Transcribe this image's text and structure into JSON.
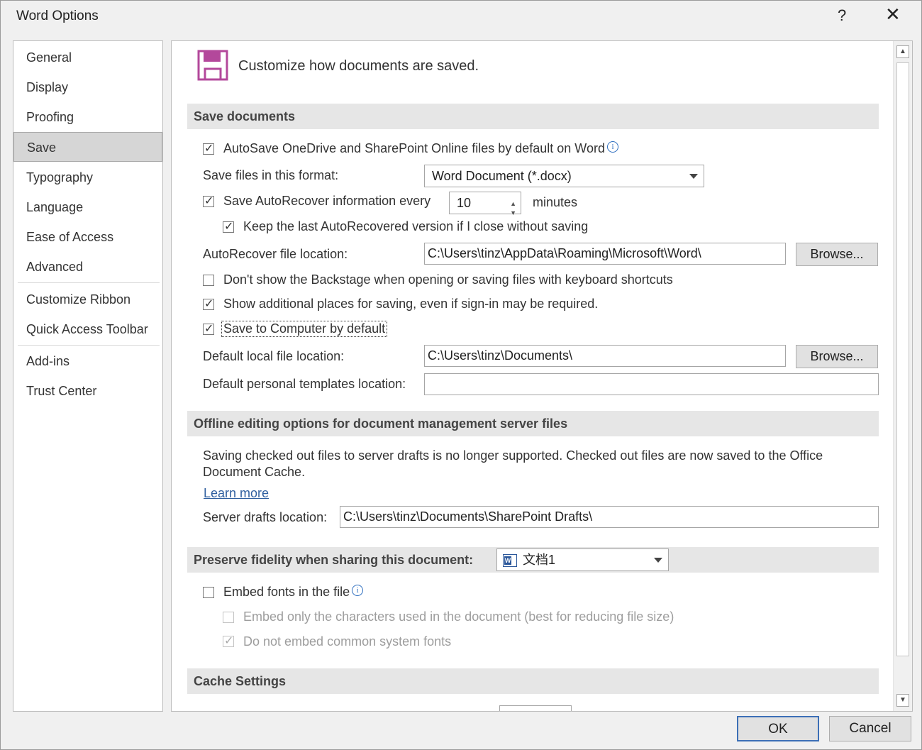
{
  "window": {
    "title": "Word Options",
    "help": "?",
    "close": "✕"
  },
  "nav": {
    "items": [
      "General",
      "Display",
      "Proofing",
      "Save",
      "Typography",
      "Language",
      "Ease of Access",
      "Advanced",
      "Customize Ribbon",
      "Quick Access Toolbar",
      "Add-ins",
      "Trust Center"
    ],
    "selected": "Save"
  },
  "header": {
    "text": "Customize how documents are saved.",
    "accent_color": "#b3489b"
  },
  "save_documents": {
    "section_title": "Save documents",
    "autosave_label": "AutoSave OneDrive and SharePoint Online files by default on Word",
    "autosave_checked": true,
    "format_label": "Save files in this format:",
    "format_value": "Word Document (*.docx)",
    "autorecover_label": "Save AutoRecover information every",
    "autorecover_checked": true,
    "autorecover_minutes": "10",
    "minutes_label": "minutes",
    "keep_last_label": "Keep the last AutoRecovered version if I close without saving",
    "keep_last_checked": true,
    "autorecover_location_label": "AutoRecover file location:",
    "autorecover_location_value": "C:\\Users\\tinz\\AppData\\Roaming\\Microsoft\\Word\\",
    "browse_label": "Browse...",
    "backstage_label": "Don't show the Backstage when opening or saving files with keyboard shortcuts",
    "backstage_checked": false,
    "additional_places_label": "Show additional places for saving, even if sign-in may be required.",
    "additional_places_checked": true,
    "save_computer_label": "Save to Computer by default",
    "save_computer_checked": true,
    "default_local_label": "Default local file location:",
    "default_local_value": "C:\\Users\\tinz\\Documents\\",
    "default_templates_label": "Default personal templates location:",
    "default_templates_value": ""
  },
  "offline": {
    "section_title": "Offline editing options for document management server files",
    "description": "Saving checked out files to server drafts is no longer supported. Checked out files are now saved to the Office Document Cache.",
    "learn_more": "Learn more",
    "server_drafts_label": "Server drafts location:",
    "server_drafts_value": "C:\\Users\\tinz\\Documents\\SharePoint Drafts\\"
  },
  "fidelity": {
    "section_title": "Preserve fidelity when sharing this document:",
    "document_value": "文档1",
    "embed_fonts_label": "Embed fonts in the file",
    "embed_fonts_checked": false,
    "embed_only_label": "Embed only the characters used in the document (best for reducing file size)",
    "embed_only_checked": false,
    "no_common_label": "Do not embed common system fonts",
    "no_common_checked": true
  },
  "cache": {
    "section_title": "Cache Settings"
  },
  "footer": {
    "ok_label": "OK",
    "cancel_label": "Cancel"
  }
}
